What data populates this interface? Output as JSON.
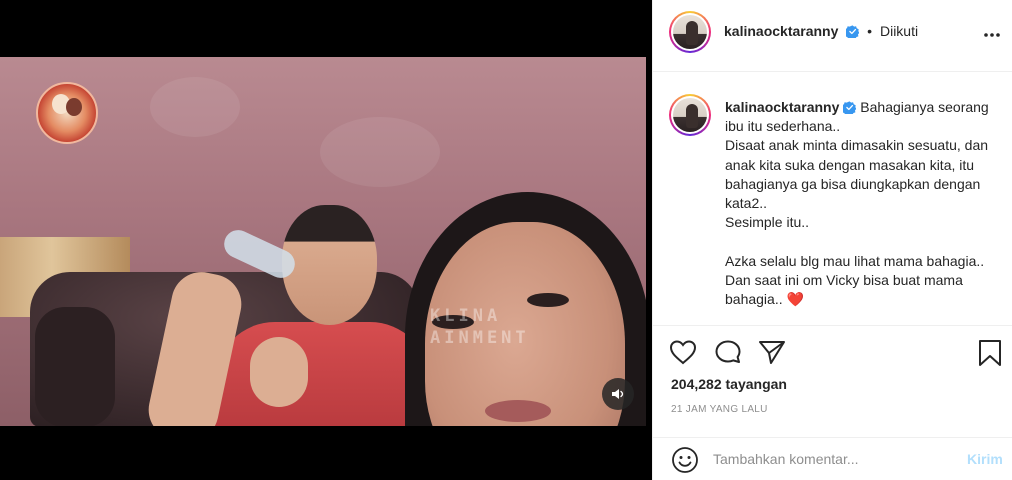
{
  "post": {
    "username": "kalinaocktaranny",
    "follow_label": "Diikuti",
    "separator": "•",
    "caption": "Bahagianya seorang ibu itu sederhana..\nDisaat anak minta dimasakin sesuatu, dan anak kita suka dengan masakan kita, itu bahagianya ga bisa diungkapkan dengan kata2..\nSesimple itu..\n\nAzka selalu blg mau lihat mama bahagia.. Dan saat ini om Vicky bisa buat mama bahagia..",
    "caption_emoji": "❤️",
    "views": "204,282 tayangan",
    "time_ago": "21 JAM YANG LALU"
  },
  "video": {
    "watermark_line1": "KLINA",
    "watermark_line2": "AINMENT"
  },
  "comment": {
    "placeholder": "Tambahkan komentar...",
    "send_label": "Kirim"
  },
  "icons": {
    "verified": "verified-badge-icon",
    "more": "more-options-icon",
    "like": "heart-icon",
    "comment": "comment-bubble-icon",
    "share": "paper-plane-icon",
    "save": "bookmark-icon",
    "emoji": "emoji-smiley-icon",
    "sound": "speaker-icon"
  },
  "colors": {
    "verified_blue": "#3897f0",
    "send_disabled": "#b2dffc",
    "text": "#262626",
    "muted": "#8e8e8e"
  }
}
